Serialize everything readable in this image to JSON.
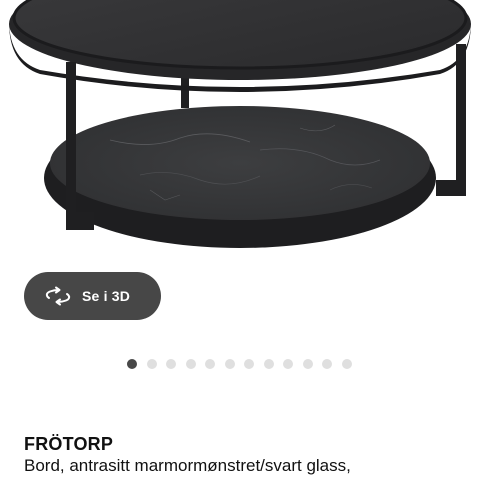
{
  "product": {
    "name": "FRÖTORP",
    "description": "Bord, antrasitt marmormønstret/svart glass,",
    "image": "round-coffee-table-image"
  },
  "view_3d": {
    "label": "Se i 3D",
    "icon": "rotate-3d-icon"
  },
  "carousel": {
    "total_slides": 12,
    "active_index": 0
  },
  "colors": {
    "button_background": "#474747",
    "dot_active": "#484848",
    "dot_inactive": "#dfdfdf"
  }
}
